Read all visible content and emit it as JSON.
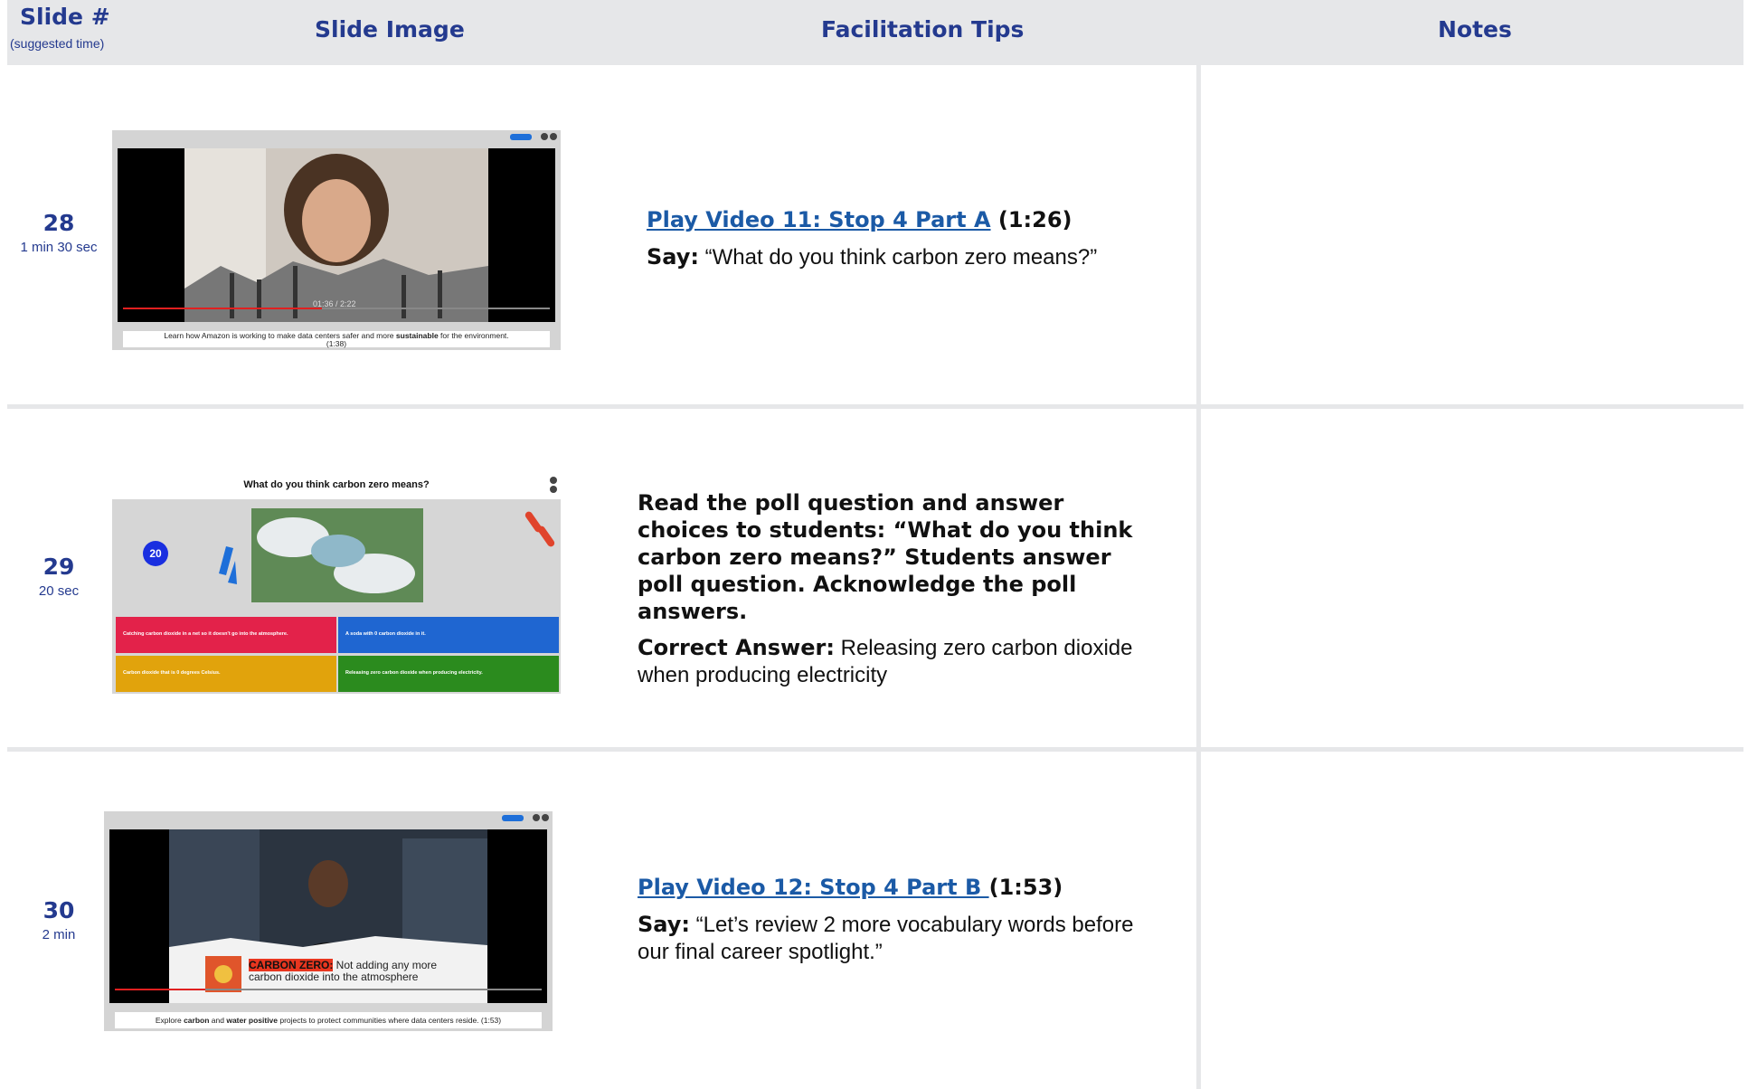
{
  "header": {
    "slide": "Slide #",
    "slide_sub": "(suggested time)",
    "image": "Slide Image",
    "tips": "Facilitation Tips",
    "notes": "Notes"
  },
  "rows": [
    {
      "number": "28",
      "time": "1 min 30 sec",
      "thumb": {
        "caption_pre": "Learn how Amazon is working to make data centers safer and more ",
        "caption_bold": "sustainable",
        "caption_post": " for the environment.",
        "caption_time": "(1:38)",
        "timecode": "01:36 / 2:22"
      },
      "link": "Play Video 11: Stop 4 Part A",
      "duration": " (1:26)",
      "say_label": "Say:",
      "say_text": " “What do you think carbon zero means?”"
    },
    {
      "number": "29",
      "time": "20 sec",
      "thumb": {
        "question": "What do you think carbon zero means?",
        "timer": "20",
        "answers": [
          "Catching carbon dioxide in a net so it doesn't go into the atmosphere.",
          "A soda with 0 carbon dioxide in it.",
          "Carbon dioxide that is 0 degrees Celsius.",
          "Releasing zero carbon dioxide when producing electricity."
        ]
      },
      "instructions": "Read the poll question and answer choices to students: “What do you think carbon zero means?” Students answer poll question. Acknowledge the poll answers.",
      "answer_label": "Correct Answer:",
      "answer_text": " Releasing zero carbon dioxide when producing electricity"
    },
    {
      "number": "30",
      "time": "2 min",
      "thumb": {
        "banner_term": "CARBON ZERO:",
        "banner_line1": " Not adding any more",
        "banner_line2": "carbon dioxide into the atmosphere",
        "caption_pre": "Explore ",
        "caption_b1": "carbon",
        "caption_mid": " and ",
        "caption_b2": "water positive",
        "caption_post": " projects to protect communities where data centers reside. (1:53)"
      },
      "link": "Play Video 12: Stop 4 Part B ",
      "duration": "(1:53)",
      "say_label": "Say:",
      "say_text": " “Let’s review 2 more vocabulary words before our final career spotlight.”"
    }
  ]
}
